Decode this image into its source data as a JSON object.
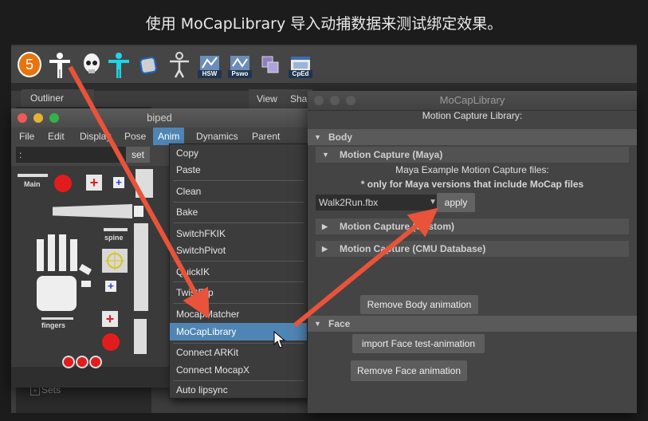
{
  "caption": "使用 MoCapLibrary 导入动捕数据来测试绑定效果。",
  "shelf": {
    "badge": "5",
    "labels": [
      "HSW",
      "Pswo",
      "CpEd"
    ]
  },
  "outliner": {
    "tab": "Outliner",
    "sets": "Sets"
  },
  "view_panel": {
    "view": "View",
    "sha": "Sha"
  },
  "biped": {
    "title": "biped",
    "menu": [
      "File",
      "Edit",
      "Display",
      "Pose",
      "Anim",
      "Dynamics",
      "Parent"
    ],
    "field_value": ":",
    "set_label": "set",
    "labels": {
      "main": "Main",
      "spine": "spine",
      "fingers": "fingers"
    }
  },
  "anim_menu": {
    "items": [
      "Copy",
      "Paste",
      "Clean",
      "Bake",
      "SwitchFKIK",
      "SwitchPivot",
      "QuickIK",
      "TwistFlip",
      "MocapMatcher",
      "MoCapLibrary",
      "Connect ARKit",
      "Connect MocapX",
      "Auto lipsync"
    ],
    "highlighted": "MoCapLibrary"
  },
  "mocap": {
    "title": "MoCapLibrary",
    "subtitle": "Motion Capture Library:",
    "body_section": "Body",
    "maya_section": "Motion Capture (Maya)",
    "maya_desc": "Maya Example Motion Capture files:",
    "maya_note": "* only for Maya versions that include MoCap files",
    "file_value": "Walk2Run.fbx",
    "apply": "apply",
    "custom_section": "Motion Capture (Custom)",
    "cmu_section": "Motion Capture (CMU Database)",
    "remove_body": "Remove Body animation",
    "face_section": "Face",
    "import_face": "import Face test-animation",
    "remove_face": "Remove Face animation"
  },
  "colors": {
    "highlight": "#4f85b4",
    "arrow": "#e8533a",
    "shelf_label_bg": "#1f3550"
  }
}
